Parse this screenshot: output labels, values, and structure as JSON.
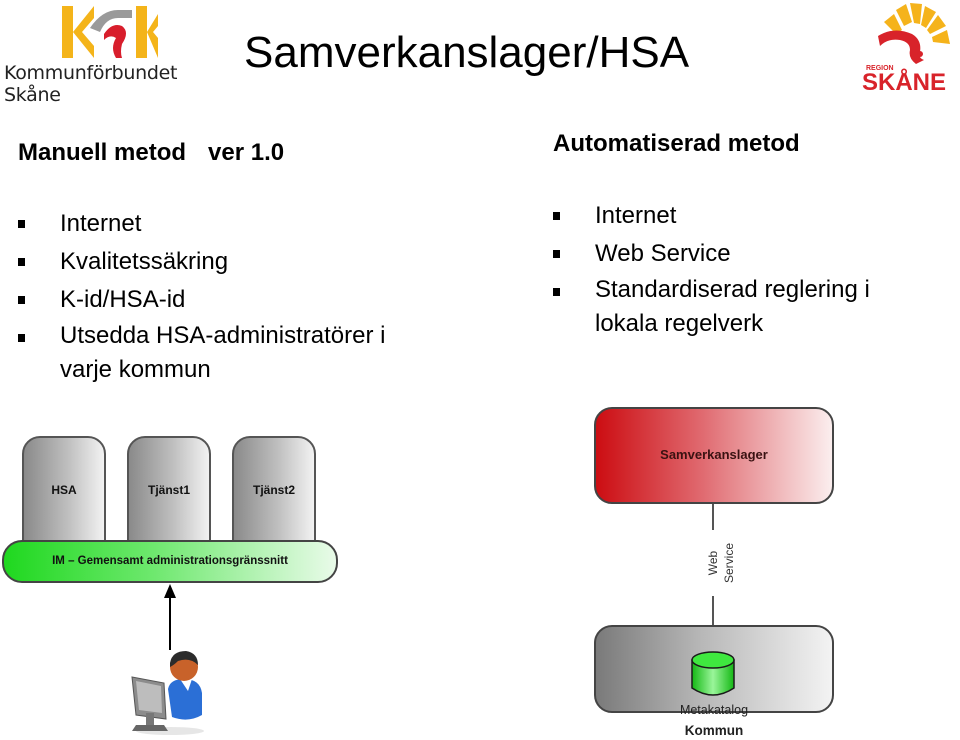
{
  "header": {
    "title": "Samverkanslager/HSA",
    "logo_left": {
      "name": "Kommunförbundet Skåne",
      "text": "Kommunförbundet Skåne",
      "mark": "KSK"
    },
    "logo_right": {
      "name": "Region Skåne",
      "small_text": "REGION",
      "big_text": "SKÅNE"
    }
  },
  "left_column": {
    "heading": "Manuell metod",
    "version": "ver 1.0",
    "bullets": [
      {
        "text": "Internet"
      },
      {
        "text": "Kvalitetssäkring"
      },
      {
        "text": "K-id/HSA-id"
      },
      {
        "text": "Utsedda HSA-administratörer i",
        "continuation": "varje kommun"
      }
    ]
  },
  "right_column": {
    "heading": "Automatiserad metod",
    "bullets": [
      {
        "text": "Internet"
      },
      {
        "text": "Web Service"
      },
      {
        "text": "Standardiserad reglering i",
        "continuation": "lokala regelverk"
      }
    ]
  },
  "diagram_manual": {
    "services": [
      "HSA",
      "Tjänst1",
      "Tjänst2"
    ],
    "interface_bar": "IM – Gemensamt administrationsgränssnitt",
    "user_icon": "user-at-computer-icon"
  },
  "diagram_auto": {
    "top_box": "Samverkanslager",
    "connector_label": "Web Service",
    "database_label": "Metakatalog",
    "container_label": "Kommun"
  },
  "colors": {
    "ksk_yellow": "#f4b41a",
    "ksk_red": "#d81e2c",
    "ksk_gray": "#9a9a9a",
    "region_red": "#d8232a",
    "region_yellow": "#f5b31b",
    "interface_green": "#1fd81f",
    "samverkan_red": "#cc0d12",
    "db_green": "#2ee82e"
  }
}
